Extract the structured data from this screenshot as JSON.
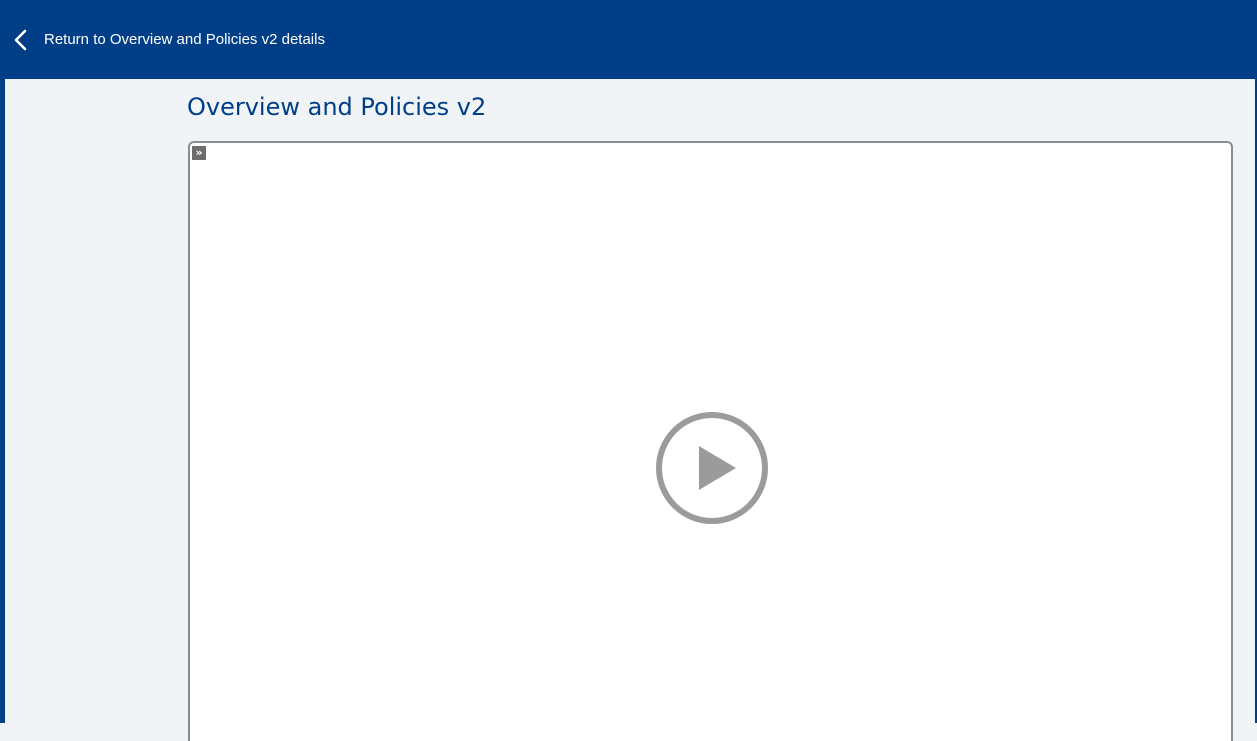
{
  "header": {
    "back_label": "Return to Overview and Policies v2 details",
    "back_icon": "chevron-left-icon",
    "background_color": "#003f87"
  },
  "main": {
    "title": "Overview and Policies v2",
    "title_color": "#003f87"
  },
  "player": {
    "expand_toggle_glyph": "»",
    "expand_icon": "double-chevron-right-icon",
    "play_icon": "play-circle-icon",
    "icon_color": "#9b9b9b"
  }
}
